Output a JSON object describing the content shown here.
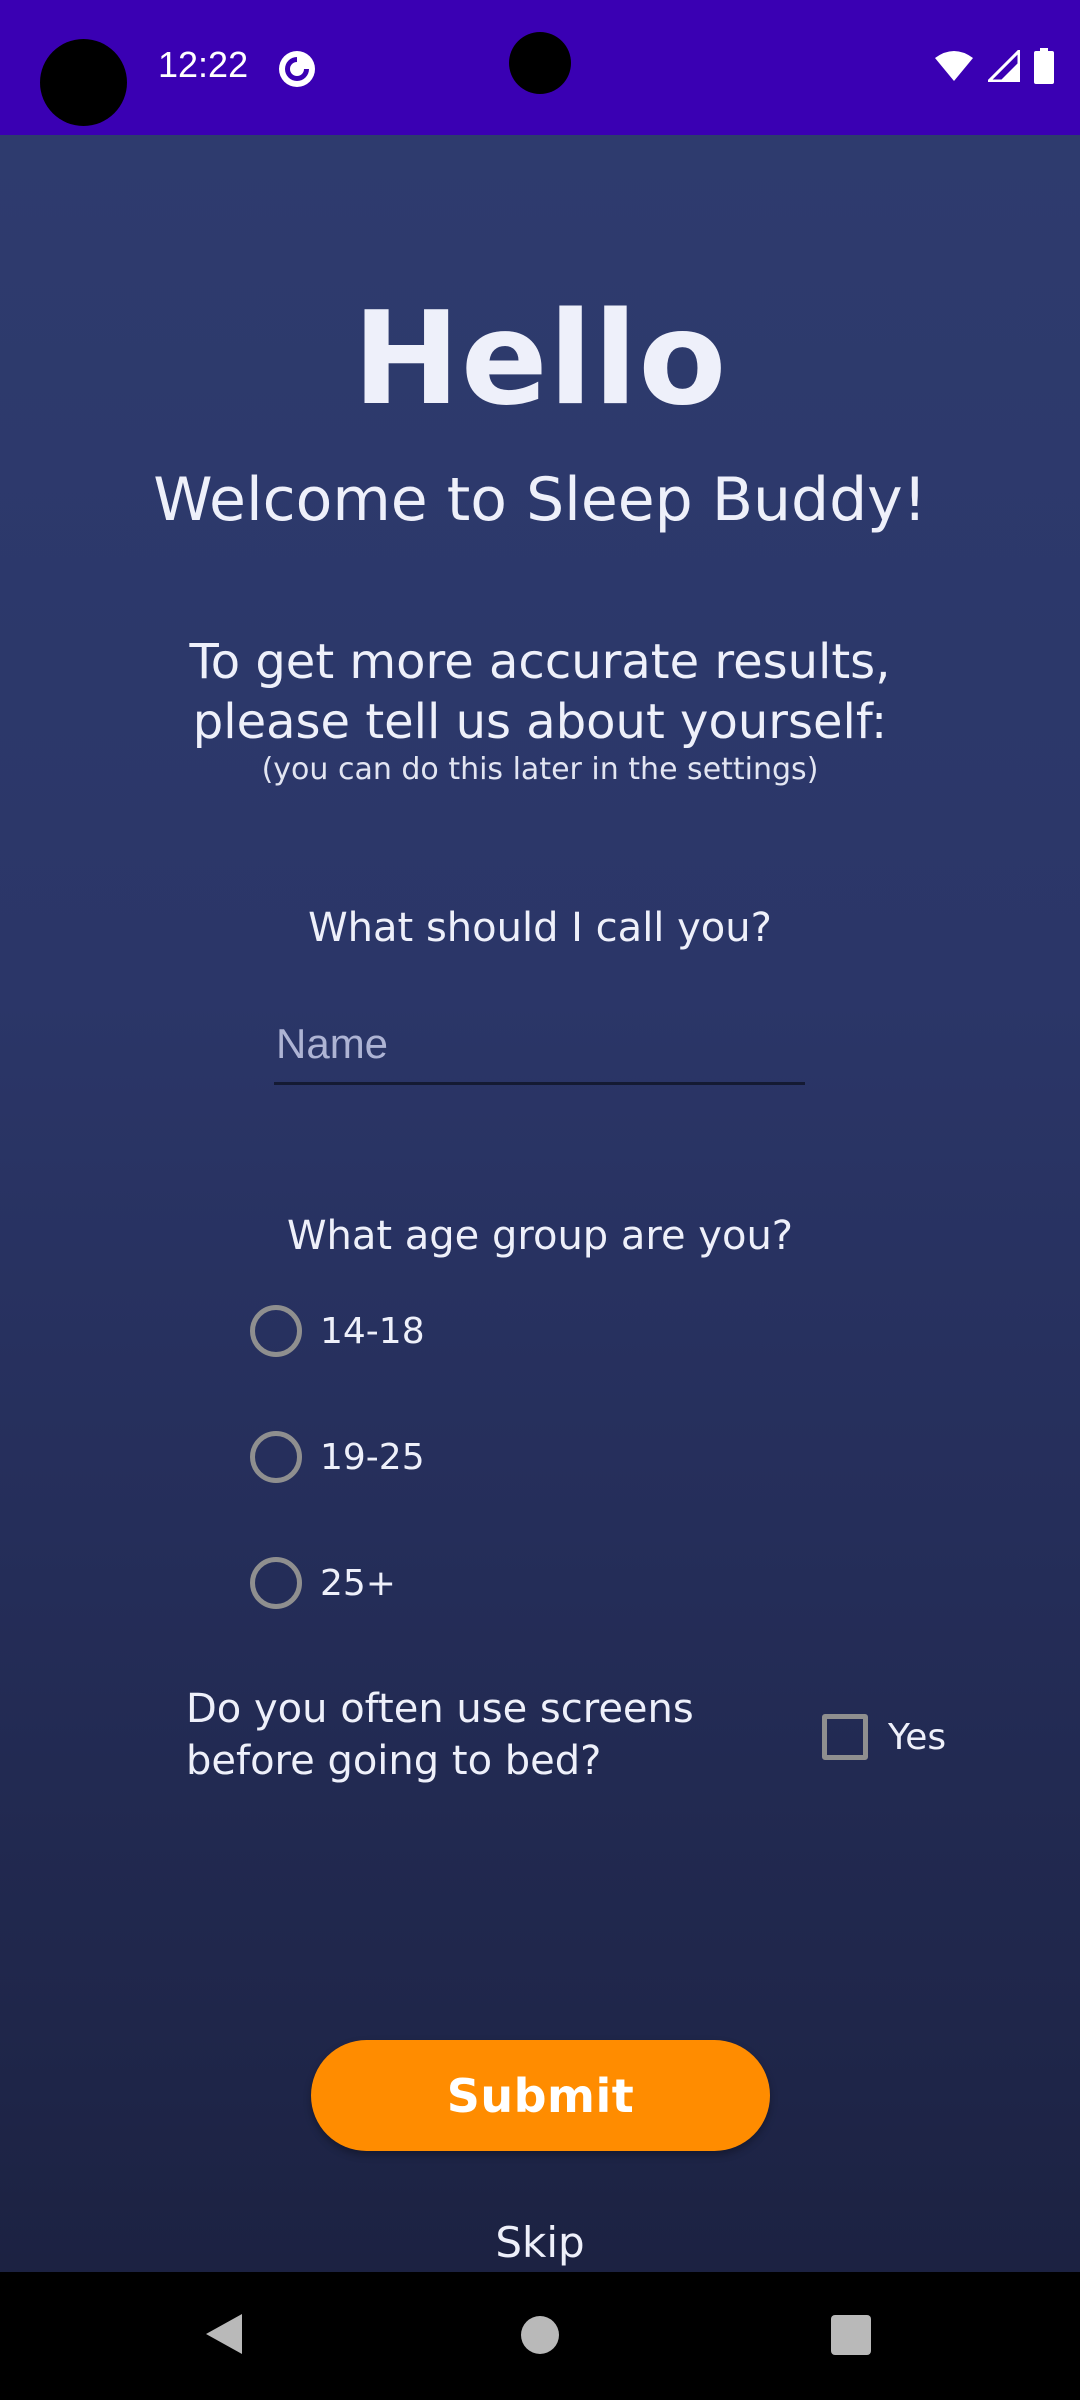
{
  "status_bar": {
    "time": "12:22",
    "app_icon": "pocket-casts-icon",
    "wifi_icon": "wifi-icon",
    "signal_icon": "cell-signal-icon",
    "battery_icon": "battery-icon",
    "background": "#3a00b3"
  },
  "header": {
    "hello": "Hello",
    "welcome": "Welcome to Sleep Buddy!"
  },
  "intro": {
    "line1": "To get more accurate results,",
    "line2": "please tell us about yourself:",
    "note": "(you can do this later in the settings)"
  },
  "name_section": {
    "question": "What should I call you?",
    "placeholder": "Name",
    "value": ""
  },
  "age_section": {
    "question": "What age group are you?",
    "options": [
      "14-18",
      "19-25",
      "25+"
    ],
    "selected": null
  },
  "screens_section": {
    "question_line1": "Do you often use screens",
    "question_line2": "before going to bed?",
    "checkbox_label": "Yes",
    "checked": false
  },
  "actions": {
    "submit": "Submit",
    "skip": "Skip"
  },
  "colors": {
    "accent": "#ff8c00",
    "background_top": "#2e3b6e",
    "background_bottom": "#1c2242",
    "text": "#eef0fa"
  },
  "nav_bar": {
    "back_icon": "back-triangle-icon",
    "home_icon": "home-circle-icon",
    "recents_icon": "recents-square-icon"
  }
}
